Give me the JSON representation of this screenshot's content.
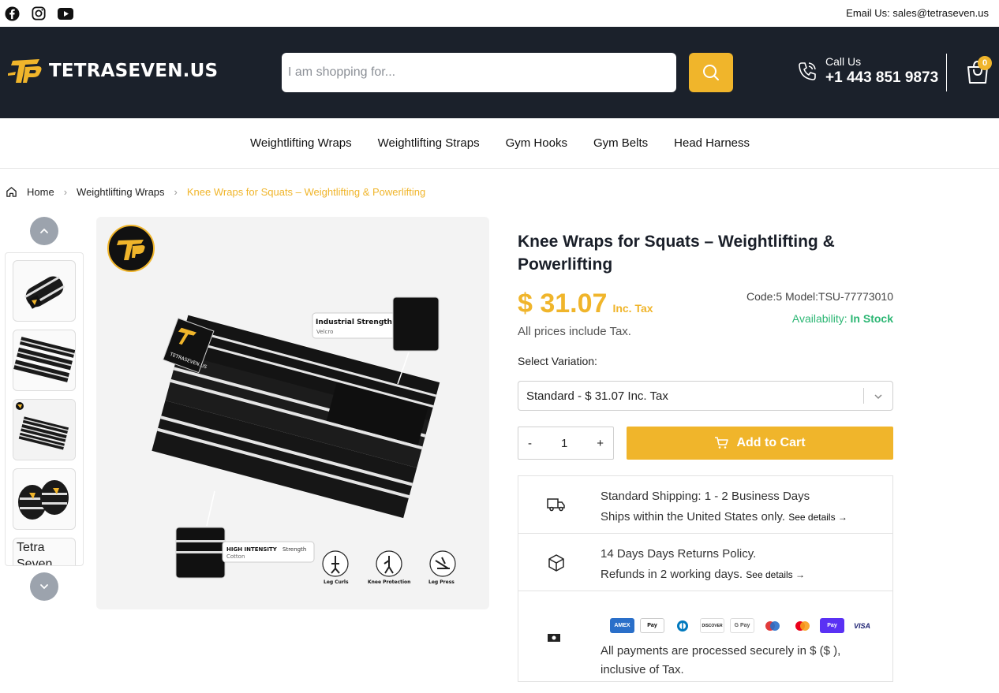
{
  "topbar": {
    "social": [
      "facebook-icon",
      "instagram-icon",
      "youtube-icon"
    ],
    "email_text": "Email Us: sales@tetraseven.us"
  },
  "header": {
    "logo_text": "TETRASEVEN.US",
    "search_placeholder": "I am shopping for...",
    "call_label": "Call Us",
    "call_number": "+1 443 851 9873",
    "cart_count": "0"
  },
  "nav": {
    "items": [
      "Weightlifting Wraps",
      "Weightlifting Straps",
      "Gym Hooks",
      "Gym Belts",
      "Head Harness"
    ]
  },
  "breadcrumb": {
    "home": "Home",
    "category": "Weightlifting Wraps",
    "current": "Knee Wraps for Squats – Weightlifting & Powerlifting"
  },
  "gallery": {
    "broken_thumb_alt": "Tetra Seven",
    "image_labels": {
      "velcro_title": "Industrial Strength",
      "velcro_sub": "Velcro",
      "cotton_title": "HIGH INTENSITY",
      "cotton_title2": "Strength",
      "cotton_sub": "Cotton",
      "use1": "Leg Curls",
      "use2": "Knee Protection",
      "use3": "Leg Press",
      "strap_text": "TETRASEVEN.US"
    }
  },
  "product": {
    "title": "Knee Wraps for Squats – Weightlifting & Powerlifting",
    "price": "$ 31.07",
    "price_suffix": "Inc. Tax",
    "price_note": "All prices include Tax.",
    "code": "Code:5  Model:TSU-77773010",
    "availability_label": "Availability:",
    "availability_value": "In Stock",
    "variation_label": "Select Variation:",
    "variation_selected": "Standard - $ 31.07 Inc. Tax",
    "qty_minus": "-",
    "qty_value": "1",
    "qty_plus": "+",
    "add_to_cart": "Add to Cart"
  },
  "info": {
    "shipping_line1": "Standard Shipping: 1 - 2 Business Days",
    "shipping_line2": "Ships within the United States only.",
    "returns_line1": "14 Days Days Returns Policy.",
    "returns_line2": "Refunds in 2 working days.",
    "see_details": "See details →",
    "payment_text_1": "All payments are processed securely in $ ($ ),",
    "payment_text_2": "inclusive of Tax.",
    "payment_methods": [
      "AMEX",
      "Apple Pay",
      "Diners",
      "DISCOVER",
      "G Pay",
      "Maestro",
      "Mastercard",
      "Shop Pay",
      "VISA"
    ]
  },
  "colors": {
    "accent": "#f0b52b",
    "header_bg": "#1b212b",
    "in_stock": "#2bb673"
  }
}
